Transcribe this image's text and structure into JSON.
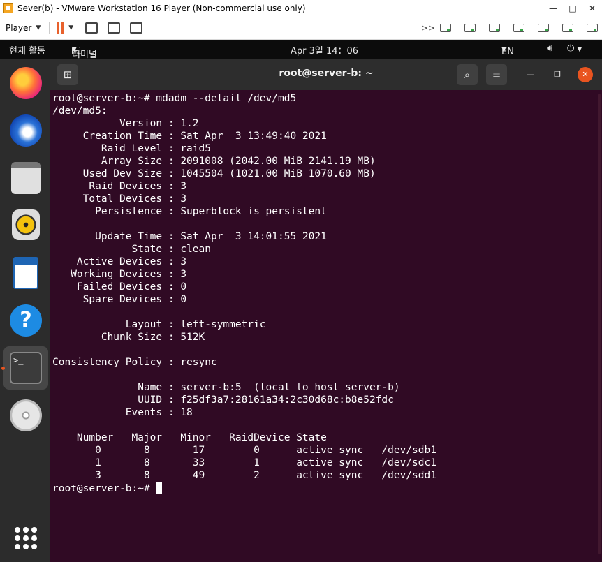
{
  "window": {
    "title": "Sever(b) - VMware Workstation 16 Player (Non-commercial use only)",
    "controls": {
      "minimize": "—",
      "maximize": "□",
      "close": "✕"
    }
  },
  "toolbar": {
    "player_label": "Player",
    "fast_forward": ">>",
    "icons": [
      "pause-icon",
      "send-ctrl-alt-del-icon",
      "fit-guest-icon",
      "unity-icon",
      "hdd-icon",
      "hdd-icon",
      "cd-icon",
      "network-icon",
      "usb-icon",
      "sound-icon",
      "display-icon"
    ]
  },
  "topbar": {
    "activities": "현재 활동",
    "app_menu": "터미널",
    "clock": "Apr 3일  14：06",
    "input_source": "EN",
    "status_icons": [
      "volume-icon",
      "power-icon"
    ]
  },
  "dock": {
    "apps": [
      "firefox-icon",
      "thunderbird-icon",
      "files-icon",
      "rhythmbox-icon",
      "writer-icon",
      "help-icon",
      "terminal-icon",
      "dvd-icon"
    ],
    "show_apps": "show-applications-icon"
  },
  "terminal": {
    "title": "root@server-b: ~",
    "new_tab_icon": "⊞",
    "search_icon": "⌕",
    "menu_icon": "≡",
    "lines": [
      "root@server-b:~# mdadm --detail /dev/md5",
      "/dev/md5:",
      "           Version : 1.2",
      "     Creation Time : Sat Apr  3 13:49:40 2021",
      "        Raid Level : raid5",
      "        Array Size : 2091008 (2042.00 MiB 2141.19 MB)",
      "     Used Dev Size : 1045504 (1021.00 MiB 1070.60 MB)",
      "      Raid Devices : 3",
      "     Total Devices : 3",
      "       Persistence : Superblock is persistent",
      "",
      "       Update Time : Sat Apr  3 14:01:55 2021",
      "             State : clean",
      "    Active Devices : 3",
      "   Working Devices : 3",
      "    Failed Devices : 0",
      "     Spare Devices : 0",
      "",
      "            Layout : left-symmetric",
      "        Chunk Size : 512K",
      "",
      "Consistency Policy : resync",
      "",
      "              Name : server-b:5  (local to host server-b)",
      "              UUID : f25df3a7:28161a34:2c30d68c:b8e52fdc",
      "            Events : 18",
      "",
      "    Number   Major   Minor   RaidDevice State",
      "       0       8       17        0      active sync   /dev/sdb1",
      "       1       8       33        1      active sync   /dev/sdc1",
      "       3       8       49        2      active sync   /dev/sdd1"
    ],
    "prompt": "root@server-b:~# "
  }
}
